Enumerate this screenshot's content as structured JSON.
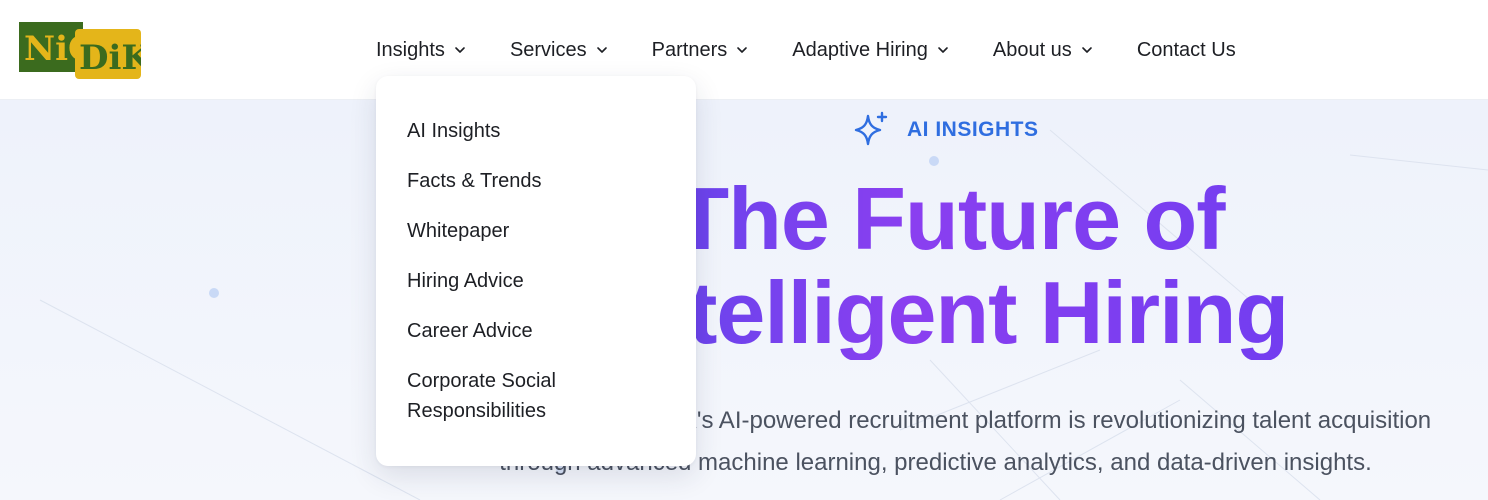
{
  "brand": {
    "logo_text_part1": "NiC",
    "logo_text_part2": "DiK",
    "logo_colors": {
      "green": "#3b6b1e",
      "gold": "#e4b51a"
    }
  },
  "nav": {
    "items": [
      {
        "label": "Insights",
        "has_dropdown": true
      },
      {
        "label": "Services",
        "has_dropdown": true
      },
      {
        "label": "Partners",
        "has_dropdown": true
      },
      {
        "label": "Adaptive Hiring",
        "has_dropdown": true
      },
      {
        "label": "About us",
        "has_dropdown": true
      },
      {
        "label": "Contact Us",
        "has_dropdown": false
      }
    ]
  },
  "insights_dropdown": {
    "items": [
      {
        "label": "AI Insights"
      },
      {
        "label": "Facts & Trends"
      },
      {
        "label": "Whitepaper"
      },
      {
        "label": "Hiring Advice"
      },
      {
        "label": "Career Advice"
      },
      {
        "label": "Corporate Social Responsibilities"
      }
    ]
  },
  "hero": {
    "eyebrow": "AI INSIGHTS",
    "eyebrow_icon": "sparkle-icon",
    "title_line1": "The Future of",
    "title_line2": "Intelligent Hiring",
    "description_line1": "Discover how NIDDIK's AI-powered recruitment platform is revolutionizing talent acquisition",
    "description_line2": "through advanced machine learning, predictive analytics, and data-driven insights."
  },
  "colors": {
    "accent_blue": "#2f6ee0",
    "title_gradient_start": "#5a46ea",
    "title_gradient_end": "#8a3ff0",
    "text_dark": "#1d1f24",
    "text_muted": "#4b5260"
  }
}
